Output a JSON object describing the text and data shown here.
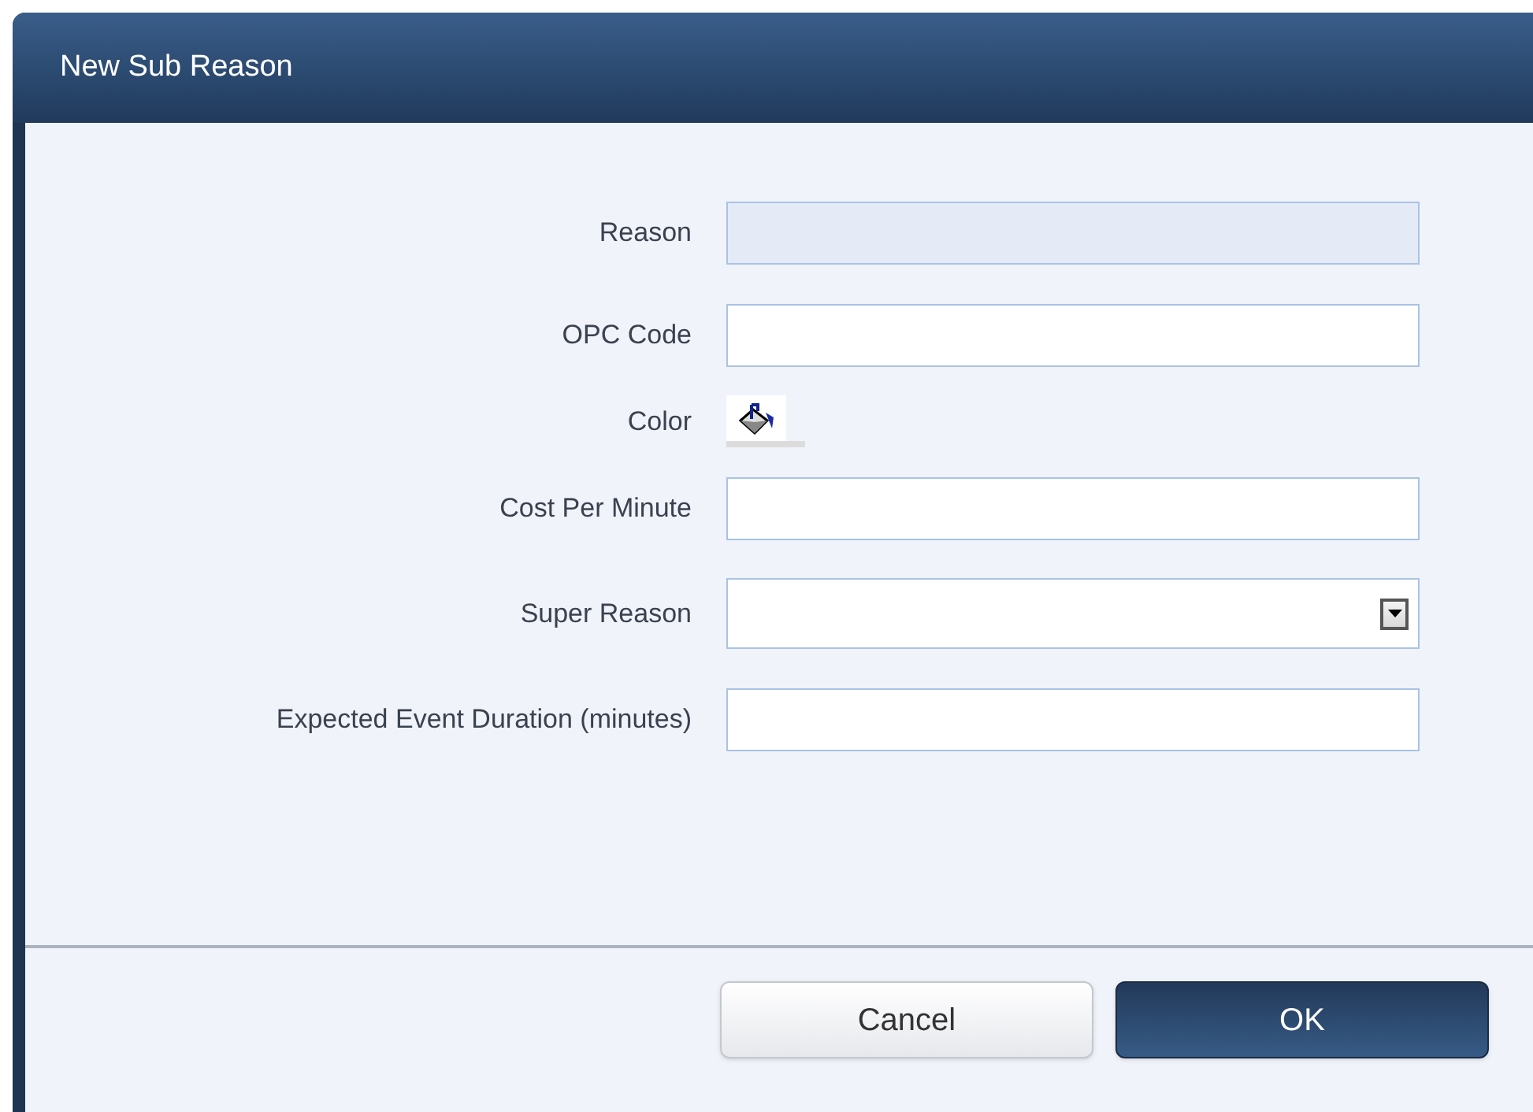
{
  "window": {
    "title": "New Sub Reason"
  },
  "fields": [
    {
      "label": "Reason",
      "kind": "text",
      "disabled": true
    },
    {
      "label": "OPC Code",
      "kind": "text",
      "disabled": false
    },
    {
      "label": "Color",
      "kind": "color"
    },
    {
      "label": "Cost Per Minute",
      "kind": "text",
      "disabled": false
    },
    {
      "label": "Super Reason",
      "kind": "dropdown",
      "disabled": false
    },
    {
      "label": "Expected Event Duration (minutes)",
      "kind": "text",
      "disabled": false
    }
  ],
  "buttons": [
    {
      "label": "Cancel",
      "kind": "secondary"
    },
    {
      "label": "OK",
      "kind": "primary"
    }
  ]
}
